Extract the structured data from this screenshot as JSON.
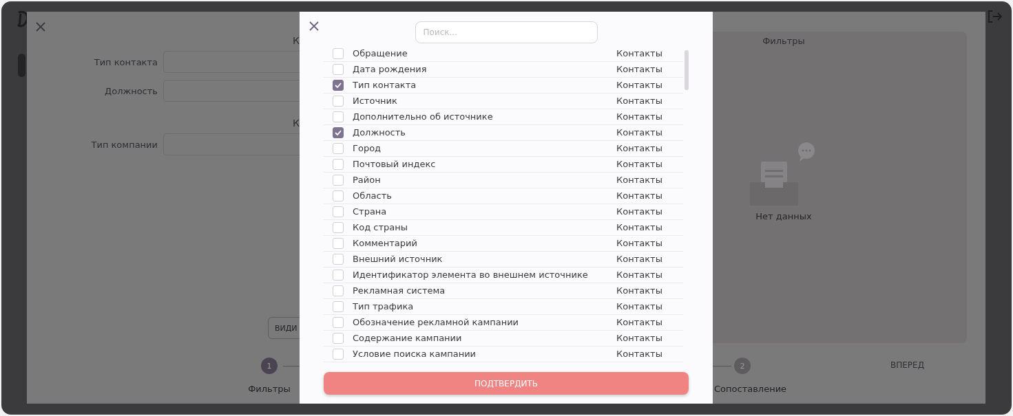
{
  "background_form": {
    "sections": [
      {
        "heading": "К",
        "fields": [
          {
            "label": "Тип контакта"
          },
          {
            "label": "Должность"
          }
        ]
      },
      {
        "heading": "К",
        "fields": [
          {
            "label": "Тип компании"
          }
        ]
      }
    ],
    "button": "ВИДИ",
    "filters_panel": {
      "title": "Фильтры",
      "empty_text": "Нет данных"
    },
    "steps": [
      {
        "number": "1",
        "label": "Фильтры"
      },
      {
        "number": "2",
        "label": "Сопоставление"
      }
    ],
    "next_button": "ВПЕРЕД"
  },
  "field_picker": {
    "search": {
      "placeholder": "Поиск..."
    },
    "rows": [
      {
        "name": "Обращение",
        "group": "Контакты",
        "checked": false
      },
      {
        "name": "Дата рождения",
        "group": "Контакты",
        "checked": false
      },
      {
        "name": "Тип контакта",
        "group": "Контакты",
        "checked": true
      },
      {
        "name": "Источник",
        "group": "Контакты",
        "checked": false
      },
      {
        "name": "Дополнительно об источнике",
        "group": "Контакты",
        "checked": false
      },
      {
        "name": "Должность",
        "group": "Контакты",
        "checked": true
      },
      {
        "name": "Город",
        "group": "Контакты",
        "checked": false
      },
      {
        "name": "Почтовый индекс",
        "group": "Контакты",
        "checked": false
      },
      {
        "name": "Район",
        "group": "Контакты",
        "checked": false
      },
      {
        "name": "Область",
        "group": "Контакты",
        "checked": false
      },
      {
        "name": "Страна",
        "group": "Контакты",
        "checked": false
      },
      {
        "name": "Код страны",
        "group": "Контакты",
        "checked": false
      },
      {
        "name": "Комментарий",
        "group": "Контакты",
        "checked": false
      },
      {
        "name": "Внешний источник",
        "group": "Контакты",
        "checked": false
      },
      {
        "name": "Идентификатор элемента во внешнем источнике",
        "group": "Контакты",
        "checked": false
      },
      {
        "name": "Рекламная система",
        "group": "Контакты",
        "checked": false
      },
      {
        "name": "Тип трафика",
        "group": "Контакты",
        "checked": false
      },
      {
        "name": "Обозначение рекламной кампании",
        "group": "Контакты",
        "checked": false
      },
      {
        "name": "Содержание кампании",
        "group": "Контакты",
        "checked": false
      },
      {
        "name": "Условие поиска кампании",
        "group": "Контакты",
        "checked": false
      }
    ],
    "confirm_button": "ПОДТВЕРДИТЬ"
  }
}
